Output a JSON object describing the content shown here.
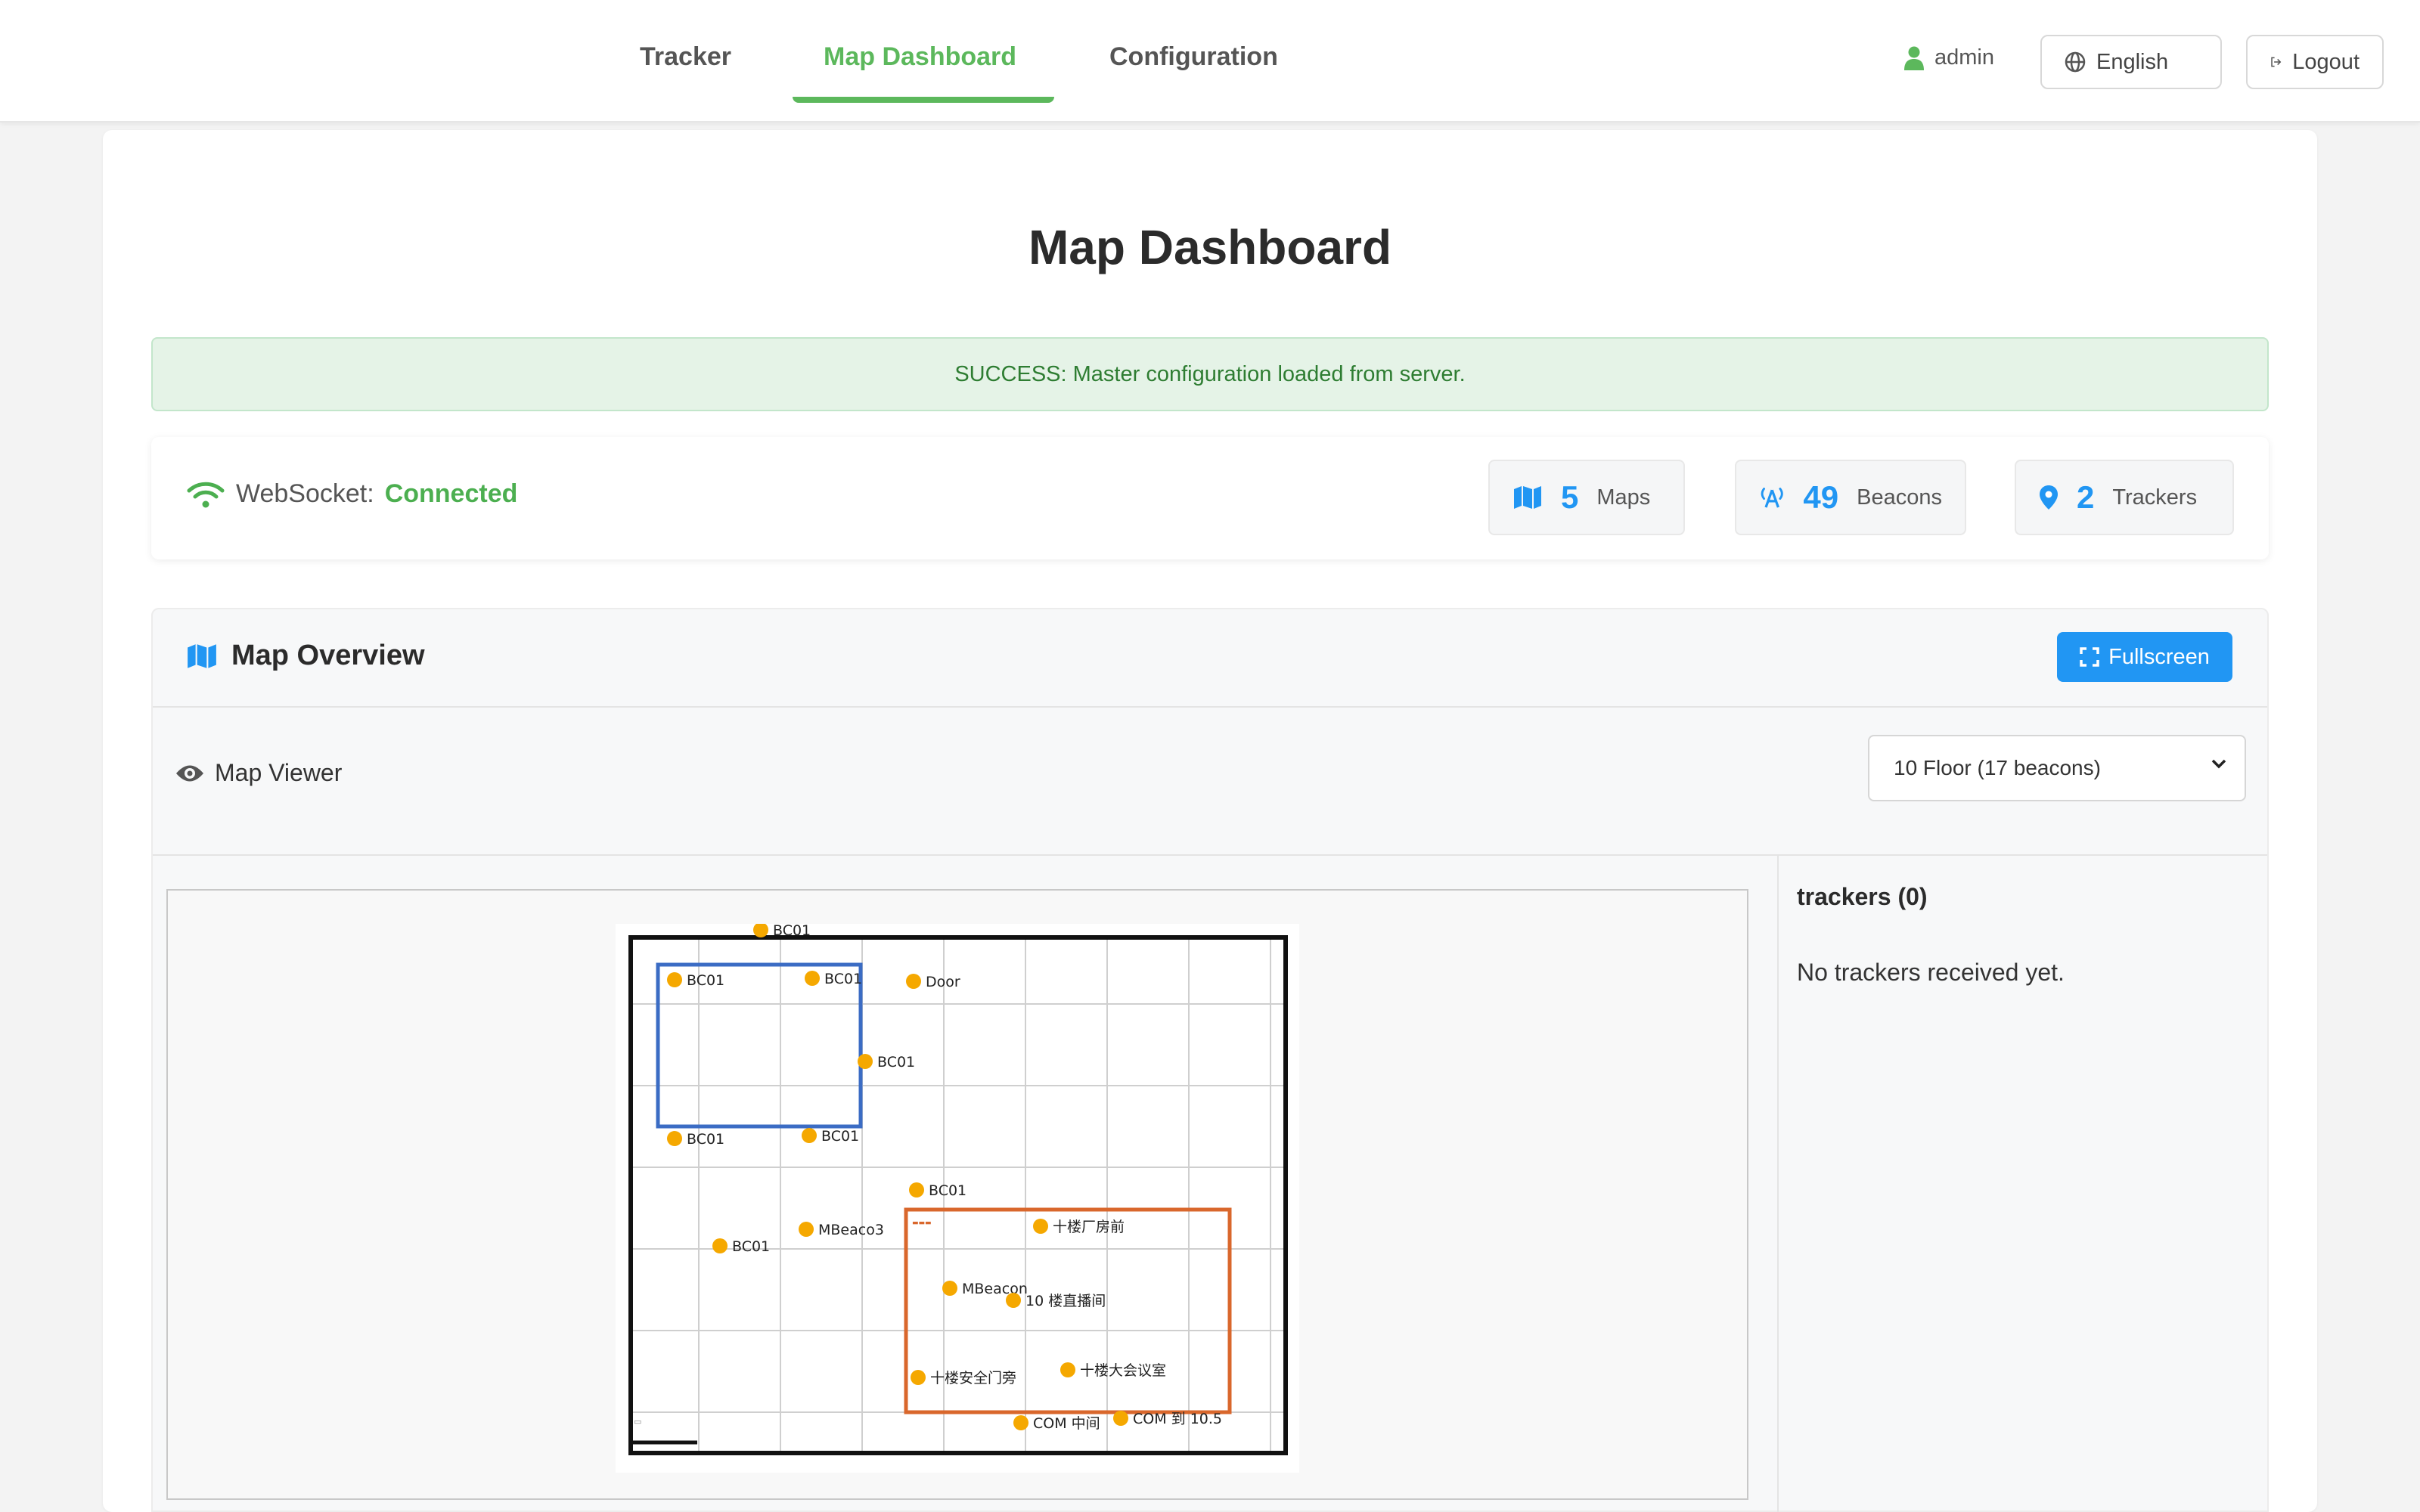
{
  "nav": {
    "tabs": [
      {
        "label": "Tracker"
      },
      {
        "label": "Map Dashboard"
      },
      {
        "label": "Configuration"
      }
    ],
    "user": "admin",
    "language": "English",
    "logout": "Logout"
  },
  "page": {
    "title": "Map Dashboard"
  },
  "alert": {
    "message": "SUCCESS: Master configuration loaded from server."
  },
  "status": {
    "ws_label": "WebSocket:",
    "ws_state": "Connected",
    "maps": {
      "count": "5",
      "label": "Maps"
    },
    "beacons": {
      "count": "49",
      "label": "Beacons"
    },
    "trackers": {
      "count": "2",
      "label": "Trackers"
    }
  },
  "overview": {
    "title": "Map Overview",
    "fullscreen": "Fullscreen",
    "viewer_label": "Map Viewer",
    "floor_selected": "10 Floor (17 beacons)"
  },
  "map": {
    "beacons": [
      {
        "label": "BC01"
      },
      {
        "label": "BC01"
      },
      {
        "label": "BC01"
      },
      {
        "label": "Door"
      },
      {
        "label": "BC01"
      },
      {
        "label": "BC01"
      },
      {
        "label": "BC01"
      },
      {
        "label": "BC01"
      },
      {
        "label": "MBeaco3"
      },
      {
        "label": "BC01"
      },
      {
        "label": "十楼厂房前"
      },
      {
        "label": "MBeacon"
      },
      {
        "label": "10 楼直播间"
      },
      {
        "label": "十楼安全门旁"
      },
      {
        "label": "十楼大会议室"
      },
      {
        "label": "COM 中间"
      },
      {
        "label": "COM 到 10.5"
      }
    ],
    "marker_color": "#f5a800",
    "zone_colors": {
      "blue": "#3b6cc4",
      "orange": "#d9672c"
    }
  },
  "trackers_panel": {
    "title": "trackers (0)",
    "empty": "No trackers received yet."
  },
  "colors": {
    "accent_green": "#5cb85c",
    "accent_blue": "#2196f3"
  }
}
